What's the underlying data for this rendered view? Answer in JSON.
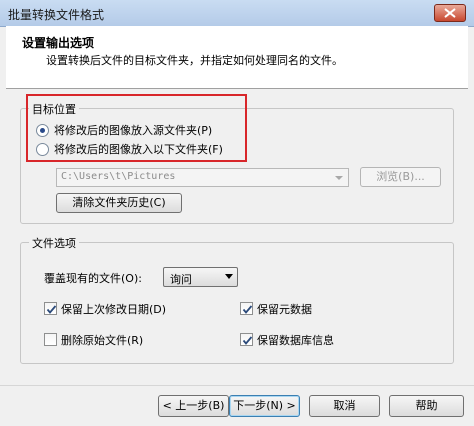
{
  "window": {
    "title": "批量转换文件格式"
  },
  "header": {
    "title": "设置输出选项",
    "subtitle": "设置转换后文件的目标文件夹，并指定如何处理同名的文件。"
  },
  "target_group": {
    "legend": "目标位置",
    "options": [
      {
        "label": "将修改后的图像放入源文件夹(P)",
        "checked": true
      },
      {
        "label": "将修改后的图像放入以下文件夹(F)",
        "checked": false
      }
    ],
    "path_value": "C:\\Users\\t\\Pictures",
    "browse_label": "浏览(B)...",
    "clear_history_label": "清除文件夹历史(C)"
  },
  "file_options": {
    "legend": "文件选项",
    "overwrite_label": "覆盖现有的文件(O):",
    "overwrite_value": "询问",
    "checkboxes": {
      "keep_date": {
        "label": "保留上次修改日期(D)",
        "checked": true
      },
      "keep_metadata": {
        "label": "保留元数据",
        "checked": true
      },
      "delete_original": {
        "label": "删除原始文件(R)",
        "checked": false
      },
      "keep_db_info": {
        "label": "保留数据库信息",
        "checked": true
      }
    }
  },
  "footer": {
    "back_label": "< 上一步(B)",
    "next_label": "下一步(N) >",
    "cancel_label": "取消",
    "help_label": "帮助"
  },
  "colors": {
    "highlight_border": "#d8262a",
    "title_bar": "#c9dcf2",
    "close_button": "#c8482f"
  },
  "icons": {
    "close": "close-icon",
    "dropdown": "chevron-down-icon",
    "check": "check-icon"
  }
}
